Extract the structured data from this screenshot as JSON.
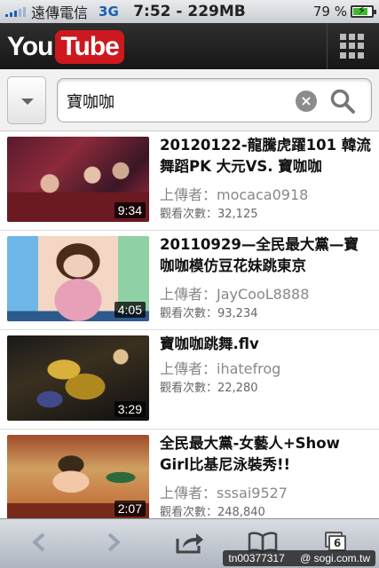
{
  "status_bar": {
    "carrier": "遠傳電信",
    "network": "3G",
    "clock": "7:52 - 229MB",
    "battery_percent": "79 %",
    "battery_level": 0.79
  },
  "header": {
    "logo_you": "You",
    "logo_tube": "Tube"
  },
  "search": {
    "query": "寶咖咖",
    "clear_icon": "×"
  },
  "results": [
    {
      "title": "20120122-龍騰虎躍101 韓流舞蹈PK 大元VS. 寶咖咖",
      "uploader": "上傳者：mocaca0918",
      "views": "觀看次數：32,125",
      "duration": "9:34"
    },
    {
      "title": "20110929—全民最大黨—寶咖咖模仿豆花妹跳東京",
      "uploader": "上傳者：JayCooL8888",
      "views": "觀看次數：93,234",
      "duration": "4:05"
    },
    {
      "title": "寶咖咖跳舞.flv",
      "uploader": "上傳者：ihatefrog",
      "views": "觀看次數：22,280",
      "duration": "3:29"
    },
    {
      "title": "全民最大黨-女藝人+Show Girl比基尼泳裝秀!!",
      "uploader": "上傳者：sssai9527",
      "views": "觀看次數：248,840",
      "duration": "2:07"
    }
  ],
  "toolbar": {
    "tab_count": "6",
    "watermark_user": "tn00377317",
    "watermark_site": "@ sogi.com.tw"
  },
  "icons": {
    "back": "back-arrow-icon",
    "forward": "forward-arrow-icon",
    "share": "share-icon",
    "bookmarks": "bookmarks-icon",
    "tabs": "tabs-icon",
    "search": "search-icon",
    "clear": "clear-icon",
    "grid": "grid-menu-icon"
  },
  "colors": {
    "youtube_red": "#cc181e",
    "header_dark": "#1f1f1f",
    "battery_green": "#3bbd2a"
  }
}
